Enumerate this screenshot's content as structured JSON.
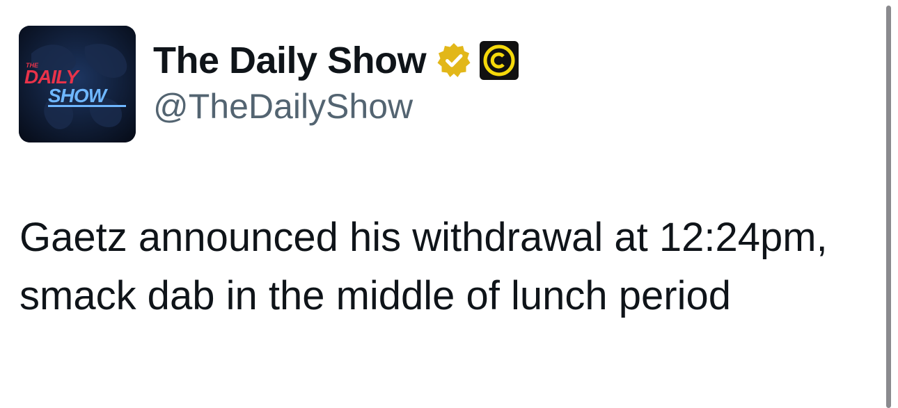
{
  "tweet": {
    "author": {
      "display_name": "The Daily Show",
      "handle": "@TheDailyShow",
      "verified_icon": "verified-gold-badge-icon",
      "affiliate_icon": "comedy-central-logo-icon",
      "avatar_logo_text": {
        "small": "THE",
        "line1": "DAILY",
        "line2": "SHOW"
      }
    },
    "text": "Gaetz announced his withdrawal at 12:24pm, smack dab in the middle of lunch period"
  },
  "colors": {
    "text_primary": "#0f1419",
    "text_secondary": "#536471",
    "verified_gold": "#e2b719",
    "logo_red": "#e8334a",
    "logo_blue": "#6fb7ff"
  }
}
